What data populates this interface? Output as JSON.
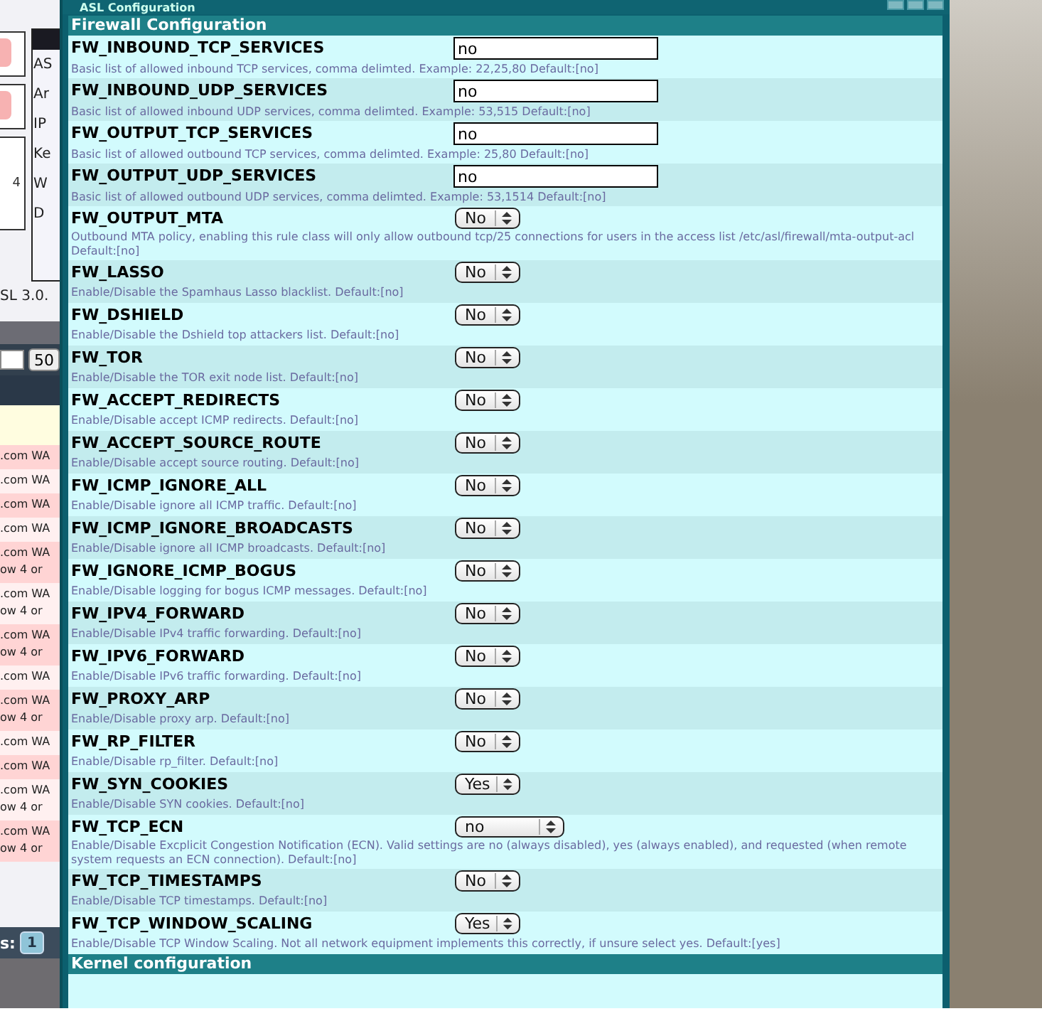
{
  "background_page": {
    "side_tabs": [
      "AS",
      "Ar",
      "IP",
      "Ke",
      "W",
      "D"
    ],
    "card_value": "4",
    "version": "SL 3.0.",
    "per_page": "50",
    "log_rows": [
      {
        "lines": [
          ".com WA"
        ]
      },
      {
        "lines": [
          ".com WA"
        ]
      },
      {
        "lines": [
          ".com WA"
        ]
      },
      {
        "lines": [
          ".com WA"
        ]
      },
      {
        "lines": [
          ".com WA",
          "ow 4 or"
        ]
      },
      {
        "lines": [
          ".com WA",
          "ow 4 or"
        ]
      },
      {
        "lines": [
          ".com WA",
          "ow 4 or"
        ]
      },
      {
        "lines": [
          ".com WA"
        ]
      },
      {
        "lines": [
          ".com WA",
          "ow 4 or"
        ]
      },
      {
        "lines": [
          ".com WA"
        ]
      },
      {
        "lines": [
          ".com WA"
        ]
      },
      {
        "lines": [
          ".com WA",
          "ow 4 or"
        ]
      },
      {
        "lines": [
          ".com WA",
          "ow 4 or"
        ]
      }
    ],
    "pages_label": "s:",
    "page": "1"
  },
  "window": {
    "title": "ASL Configuration",
    "section": "Firewall Configuration",
    "settings": [
      {
        "name": "FW_INBOUND_TCP_SERVICES",
        "kind": "text",
        "value": "no",
        "description": "Basic list of allowed inbound TCP services, comma delimted. Example: 22,25,80 Default:[no]"
      },
      {
        "name": "FW_INBOUND_UDP_SERVICES",
        "kind": "text",
        "value": "no",
        "description": "Basic list of allowed inbound UDP services, comma delimted. Example: 53,515 Default:[no]"
      },
      {
        "name": "FW_OUTPUT_TCP_SERVICES",
        "kind": "text",
        "value": "no",
        "description": "Basic list of allowed outbound TCP services, comma delimted. Example: 25,80 Default:[no]"
      },
      {
        "name": "FW_OUTPUT_UDP_SERVICES",
        "kind": "text",
        "value": "no",
        "description": "Basic list of allowed outbound UDP services, comma delimted. Example: 53,1514 Default:[no]"
      },
      {
        "name": "FW_OUTPUT_MTA",
        "kind": "select",
        "value": "No",
        "description": "Outbound MTA policy, enabling this rule class will only allow outbound tcp/25 connections for users in the access list /etc/asl/firewall/mta-output-acl Default:[no]"
      },
      {
        "name": "FW_LASSO",
        "kind": "select",
        "value": "No",
        "description": "Enable/Disable the Spamhaus Lasso blacklist. Default:[no]"
      },
      {
        "name": "FW_DSHIELD",
        "kind": "select",
        "value": "No",
        "description": "Enable/Disable the Dshield top attackers list. Default:[no]"
      },
      {
        "name": "FW_TOR",
        "kind": "select",
        "value": "No",
        "description": "Enable/Disable the TOR exit node list. Default:[no]"
      },
      {
        "name": "FW_ACCEPT_REDIRECTS",
        "kind": "select",
        "value": "No",
        "description": "Enable/Disable accept ICMP redirects. Default:[no]"
      },
      {
        "name": "FW_ACCEPT_SOURCE_ROUTE",
        "kind": "select",
        "value": "No",
        "description": "Enable/Disable accept source routing. Default:[no]"
      },
      {
        "name": "FW_ICMP_IGNORE_ALL",
        "kind": "select",
        "value": "No",
        "description": "Enable/Disable ignore all ICMP traffic. Default:[no]"
      },
      {
        "name": "FW_ICMP_IGNORE_BROADCASTS",
        "kind": "select",
        "value": "No",
        "description": "Enable/Disable ignore all ICMP broadcasts. Default:[no]"
      },
      {
        "name": "FW_IGNORE_ICMP_BOGUS",
        "kind": "select",
        "value": "No",
        "description": "Enable/Disable logging for bogus ICMP messages. Default:[no]"
      },
      {
        "name": "FW_IPV4_FORWARD",
        "kind": "select",
        "value": "No",
        "description": "Enable/Disable IPv4 traffic forwarding. Default:[no]"
      },
      {
        "name": "FW_IPV6_FORWARD",
        "kind": "select",
        "value": "No",
        "description": "Enable/Disable IPv6 traffic forwarding. Default:[no]"
      },
      {
        "name": "FW_PROXY_ARP",
        "kind": "select",
        "value": "No",
        "description": "Enable/Disable proxy arp. Default:[no]"
      },
      {
        "name": "FW_RP_FILTER",
        "kind": "select",
        "value": "No",
        "description": "Enable/Disable rp_filter. Default:[no]"
      },
      {
        "name": "FW_SYN_COOKIES",
        "kind": "select",
        "value": "Yes",
        "description": "Enable/Disable SYN cookies. Default:[no]"
      },
      {
        "name": "FW_TCP_ECN",
        "kind": "wide_select",
        "value": "no",
        "description": "Enable/Disable Excplicit Congestion Notification (ECN). Valid settings are no (always disabled), yes (always enabled), and requested (when remote system requests an ECN connection). Default:[no]"
      },
      {
        "name": "FW_TCP_TIMESTAMPS",
        "kind": "select",
        "value": "No",
        "description": "Enable/Disable TCP timestamps. Default:[no]"
      },
      {
        "name": "FW_TCP_WINDOW_SCALING",
        "kind": "select",
        "value": "Yes",
        "description": "Enable/Disable TCP Window Scaling. Not all network equipment implements this correctly, if unsure select yes. Default:[yes]"
      }
    ],
    "next_section": "Kernel configuration"
  }
}
